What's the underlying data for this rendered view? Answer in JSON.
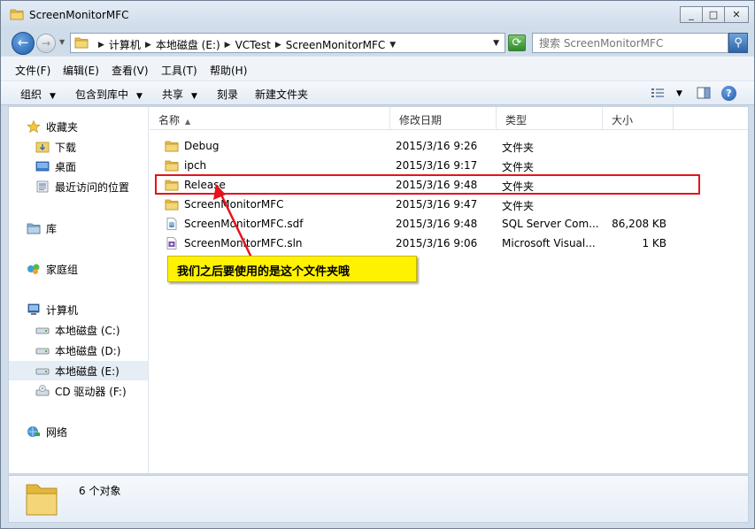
{
  "window": {
    "title": "ScreenMonitorMFC",
    "minimize": "_",
    "maximize": "□",
    "close": "✕"
  },
  "address": {
    "crumbs": [
      "计算机",
      "本地磁盘 (E:)",
      "VCTest",
      "ScreenMonitorMFC"
    ],
    "search_placeholder": "搜索 ScreenMonitorMFC"
  },
  "menu": [
    "文件(F)",
    "编辑(E)",
    "查看(V)",
    "工具(T)",
    "帮助(H)"
  ],
  "toolbar": {
    "organize": "组织",
    "include_library": "包含到库中",
    "share": "共享",
    "burn": "刻录",
    "new_folder": "新建文件夹"
  },
  "nav": {
    "favorites": "收藏夹",
    "downloads": "下载",
    "desktop": "桌面",
    "recent": "最近访问的位置",
    "libraries": "库",
    "homegroup": "家庭组",
    "computer": "计算机",
    "drive_c": "本地磁盘 (C:)",
    "drive_d": "本地磁盘 (D:)",
    "drive_e": "本地磁盘 (E:)",
    "drive_f": "CD 驱动器 (F:)",
    "network": "网络"
  },
  "columns": {
    "name": "名称",
    "date": "修改日期",
    "type": "类型",
    "size": "大小"
  },
  "files": [
    {
      "name": "Debug",
      "date": "2015/3/16 9:26",
      "type": "文件夹",
      "size": "",
      "icon": "folder-icon"
    },
    {
      "name": "ipch",
      "date": "2015/3/16 9:17",
      "type": "文件夹",
      "size": "",
      "icon": "folder-icon"
    },
    {
      "name": "Release",
      "date": "2015/3/16 9:48",
      "type": "文件夹",
      "size": "",
      "icon": "folder-icon"
    },
    {
      "name": "ScreenMonitorMFC",
      "date": "2015/3/16 9:47",
      "type": "文件夹",
      "size": "",
      "icon": "folder-icon"
    },
    {
      "name": "ScreenMonitorMFC.sdf",
      "date": "2015/3/16 9:48",
      "type": "SQL Server Com...",
      "size": "86,208 KB",
      "icon": "sdf-file-icon"
    },
    {
      "name": "ScreenMonitorMFC.sln",
      "date": "2015/3/16 9:06",
      "type": "Microsoft Visual...",
      "size": "1 KB",
      "icon": "sln-file-icon"
    }
  ],
  "annotation": {
    "callout": "我们之后要使用的是这个文件夹哦",
    "color": "#e4141b",
    "callout_bg": "#fff200"
  },
  "status": {
    "count": "6 个对象"
  }
}
